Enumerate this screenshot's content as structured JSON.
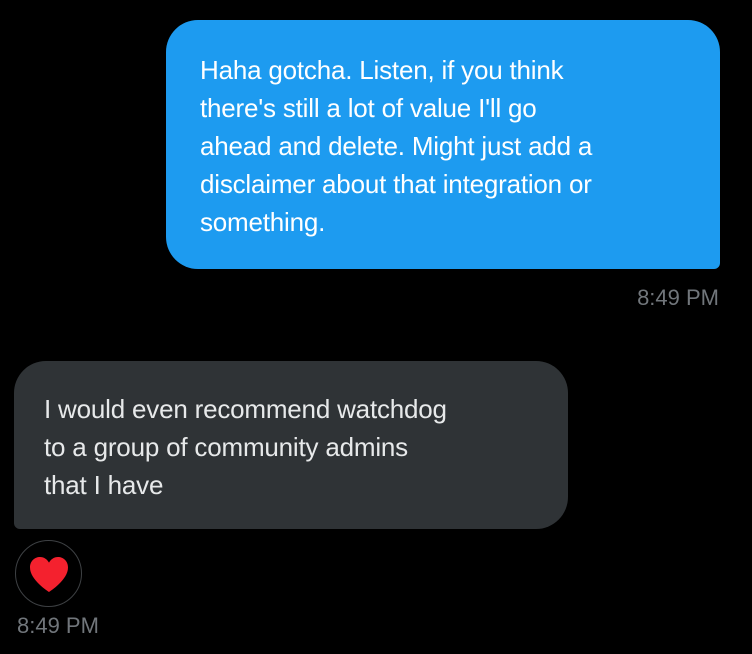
{
  "conversation": {
    "sent_message": {
      "text": "Haha gotcha. Listen, if you think\nthere's still a lot of value I'll go\nahead and delete. Might just add a\ndisclaimer about that integration or\nsomething.",
      "time": "8:49 PM",
      "bubble_color": "#1d9bf0"
    },
    "received_message": {
      "text": "I would even recommend watchdog\nto a group of community admins\nthat I have",
      "time": "8:49 PM",
      "bubble_color": "#2f3336",
      "reaction": {
        "icon": "heart-icon",
        "color": "#f91880"
      }
    }
  }
}
